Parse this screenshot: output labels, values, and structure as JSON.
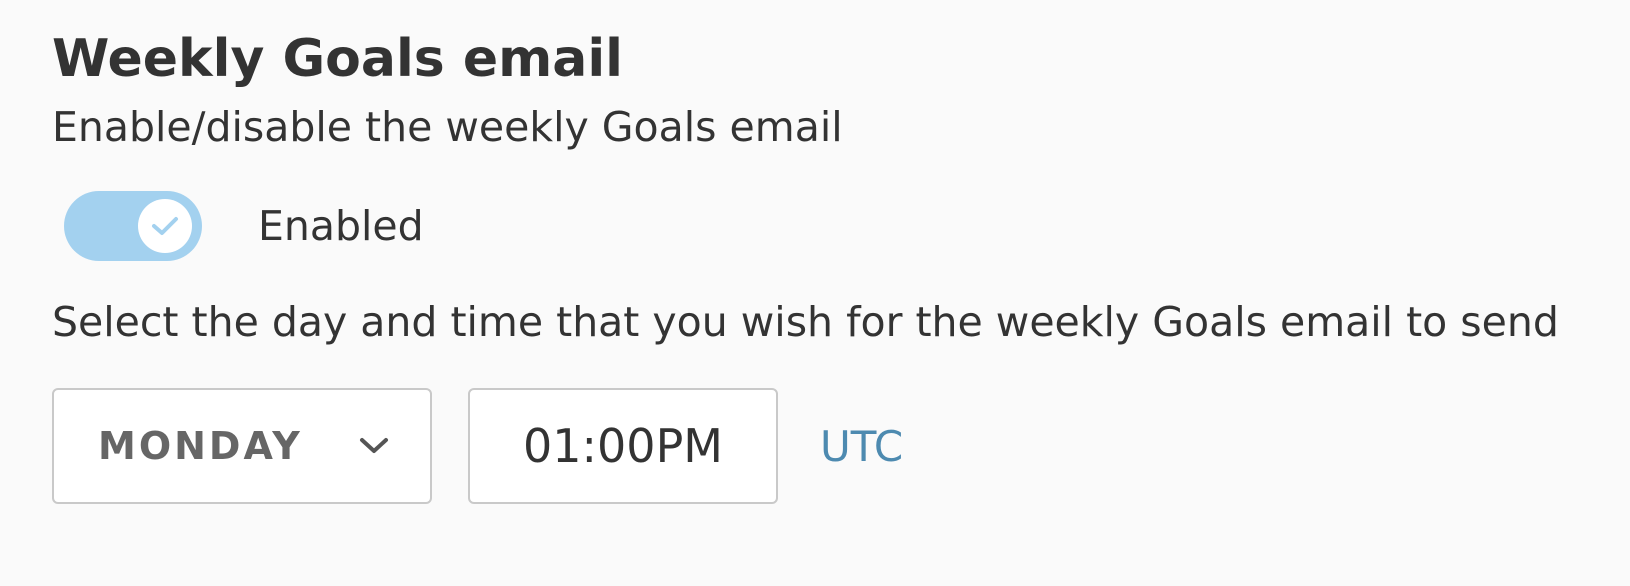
{
  "section": {
    "title": "Weekly Goals email",
    "subtitle": "Enable/disable the weekly Goals email"
  },
  "toggle": {
    "state": "on",
    "label": "Enabled",
    "track_color": "#a3d1ef",
    "icon": "check-icon"
  },
  "schedule": {
    "instruction": "Select the day and time that you wish for the weekly Goals email to send",
    "day_value": "MONDAY",
    "day_icon": "chevron-down-icon",
    "time_value": "01:00PM",
    "timezone": "UTC",
    "timezone_color": "#4d8ab0"
  }
}
